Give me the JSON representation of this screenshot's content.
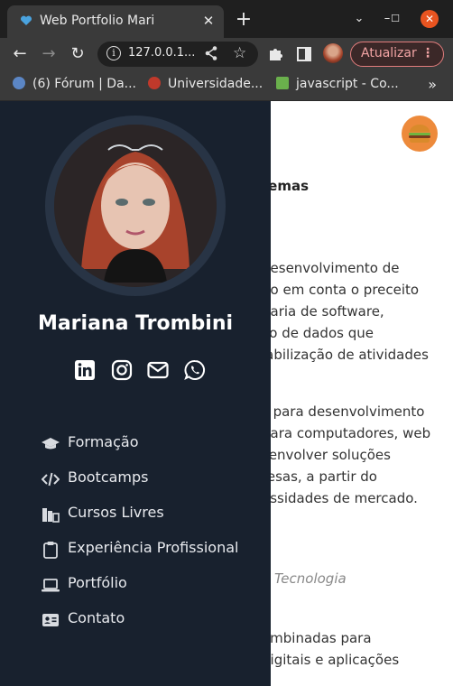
{
  "browser": {
    "tab_title": "Web Portfolio Mari",
    "url": "127.0.0.1...",
    "update_label": "Atualizar",
    "bookmarks": [
      {
        "label": "(6) Fórum | Da..."
      },
      {
        "label": "Universidade..."
      },
      {
        "label": "javascript - Co..."
      }
    ],
    "bookmarks_more": "»"
  },
  "profile": {
    "name": "Mariana Trombini"
  },
  "nav": {
    "items": [
      {
        "label": "Formação",
        "icon": "graduation-cap-icon"
      },
      {
        "label": "Bootcamps",
        "icon": "code-icon"
      },
      {
        "label": "Cursos Livres",
        "icon": "books-icon"
      },
      {
        "label": "Experiência Profissional",
        "icon": "clipboard-icon"
      },
      {
        "label": "Portfólio",
        "icon": "laptop-icon"
      },
      {
        "label": "Contato",
        "icon": "contact-card-icon"
      }
    ]
  },
  "content": {
    "lines": [
      "temas",
      "desenvolvimento de",
      "do em conta o preceito",
      "haria de software,",
      "co de dados que",
      "iabilização de atividades",
      "s para desenvolvimento",
      "para computadores, web",
      "senvolver soluções",
      "resas, a partir do",
      "essidades de mercado.",
      "e Tecnologia",
      "ombinadas para",
      "digitais e aplicações"
    ]
  },
  "colors": {
    "sidebar_bg": "#18212e",
    "accent_orange": "#ed8a3b",
    "update_red": "#e27d7d"
  }
}
